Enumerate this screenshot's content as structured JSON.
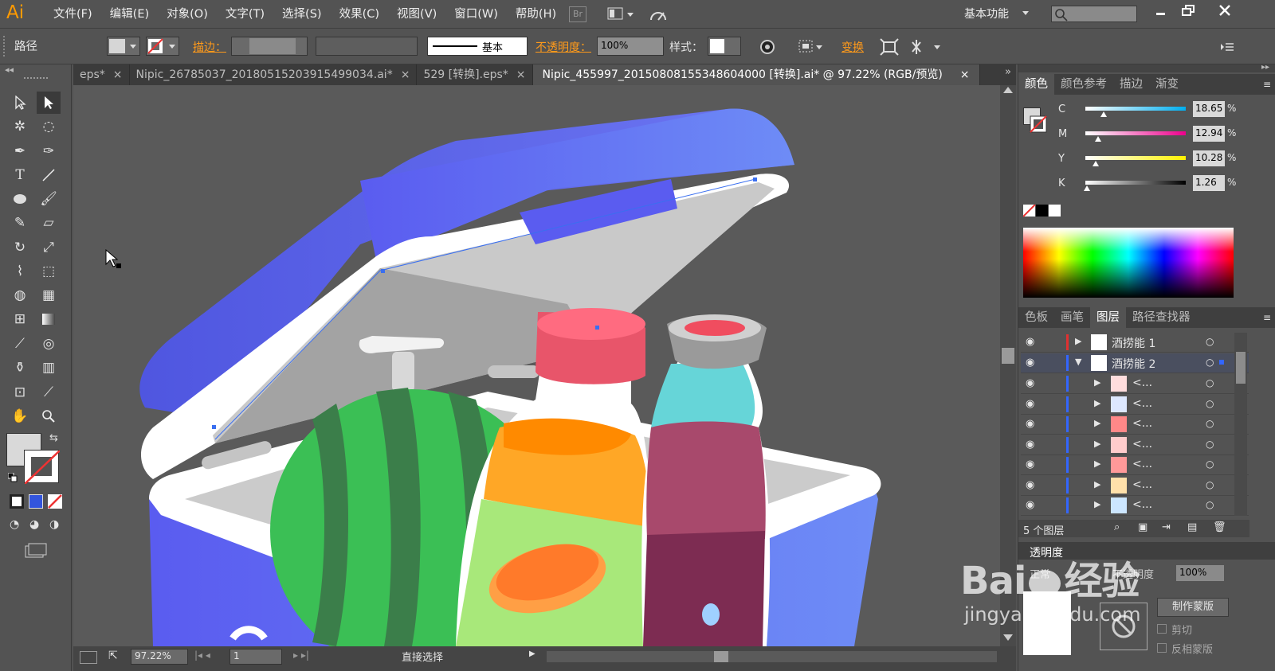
{
  "app": {
    "logo": "Ai"
  },
  "menu": [
    "文件(F)",
    "编辑(E)",
    "对象(O)",
    "文字(T)",
    "选择(S)",
    "效果(C)",
    "视图(V)",
    "窗口(W)",
    "帮助(H)"
  ],
  "menubar_right": {
    "bridge": "Br",
    "workspace": "基本功能"
  },
  "control": {
    "path_label": "路径",
    "stroke_label": "描边：",
    "stroke_style_label": "基本",
    "opacity_label": "不透明度：",
    "opacity_value": "100%",
    "style_label": "样式：",
    "transform_label": "变换"
  },
  "tabs": [
    {
      "label": "eps*",
      "close": "×"
    },
    {
      "label": "Nipic_26785037_20180515203915499034.ai*",
      "close": "×"
    },
    {
      "label": "529 [转换].eps*",
      "close": "×"
    },
    {
      "label": "Nipic_455997_20150808155348604000 [转换].ai* @ 97.22% (RGB/预览)",
      "close": "×"
    }
  ],
  "status": {
    "zoom": "97.22%",
    "page": "1",
    "tool": "直接选择"
  },
  "color_panel": {
    "tabs": [
      "颜色",
      "颜色参考",
      "描边",
      "渐变"
    ],
    "sliders": [
      {
        "label": "C",
        "value": "18.65",
        "unit": "%",
        "fraction": 0.1865
      },
      {
        "label": "M",
        "value": "12.94",
        "unit": "%",
        "fraction": 0.1294
      },
      {
        "label": "Y",
        "value": "10.28",
        "unit": "%",
        "fraction": 0.1028
      },
      {
        "label": "K",
        "value": "1.26",
        "unit": "%",
        "fraction": 0.0126
      }
    ]
  },
  "layers_panel": {
    "tabs": [
      "色板",
      "画笔",
      "图层",
      "路径查找器"
    ],
    "layers": [
      {
        "name": "酒捞能 1",
        "color": "#e03030",
        "expanded": false
      },
      {
        "name": "酒捞能 2",
        "color": "#3366ff",
        "expanded": true
      }
    ],
    "sublayers": [
      "<...",
      "<...",
      "<...",
      "<...",
      "<...",
      "<...",
      "<..."
    ],
    "count": "5 个图层"
  },
  "transparency_panel": {
    "title": "透明度",
    "mode": "正常",
    "opacity_label": "不透明度",
    "opacity_value": "100%",
    "make_mask": "制作蒙版",
    "clip": "剪切",
    "invert": "反相蒙版"
  },
  "watermark": {
    "brand": "Bai",
    "brand2": "经验",
    "url": "jingyan.baidu.com"
  }
}
